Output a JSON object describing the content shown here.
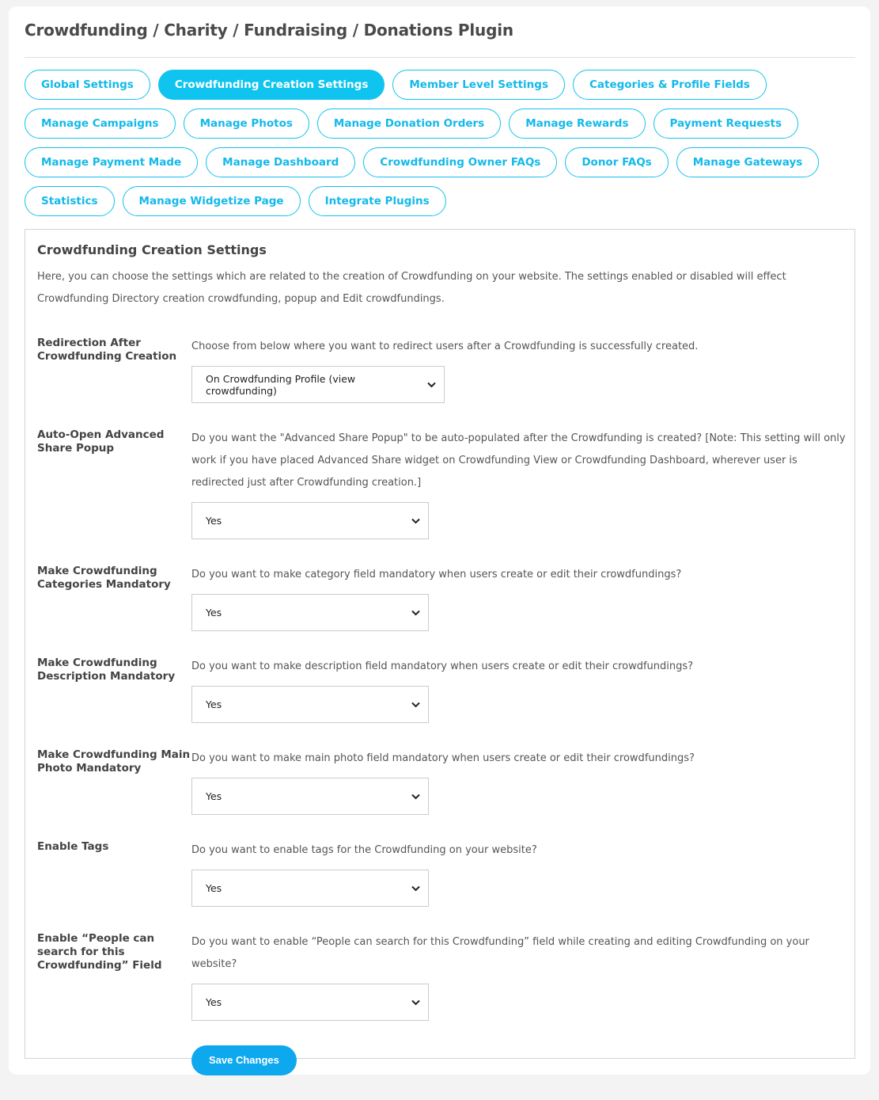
{
  "title": "Crowdfunding / Charity / Fundraising / Donations Plugin",
  "tabs": [
    {
      "label": "Global Settings",
      "active": false
    },
    {
      "label": "Crowdfunding Creation Settings",
      "active": true
    },
    {
      "label": "Member Level Settings",
      "active": false
    },
    {
      "label": "Categories & Profile Fields",
      "active": false
    },
    {
      "label": "Manage Campaigns",
      "active": false
    },
    {
      "label": "Manage Photos",
      "active": false
    },
    {
      "label": "Manage Donation Orders",
      "active": false
    },
    {
      "label": "Manage Rewards",
      "active": false
    },
    {
      "label": "Payment Requests",
      "active": false
    },
    {
      "label": "Manage Payment Made",
      "active": false
    },
    {
      "label": "Manage Dashboard",
      "active": false
    },
    {
      "label": "Crowdfunding Owner FAQs",
      "active": false
    },
    {
      "label": "Donor FAQs",
      "active": false
    },
    {
      "label": "Manage Gateways",
      "active": false
    },
    {
      "label": "Statistics",
      "active": false
    },
    {
      "label": "Manage Widgetize Page",
      "active": false
    },
    {
      "label": "Integrate Plugins",
      "active": false
    }
  ],
  "section": {
    "title": "Crowdfunding Creation Settings",
    "description": "Here, you can choose the settings which are related to the creation of Crowdfunding on your website. The settings enabled or disabled will effect Crowdfunding Directory creation crowdfunding, popup and Edit crowdfundings.",
    "settings": [
      {
        "label": "Redirection After Crowdfunding Creation",
        "description": "Choose from below where you want to redirect users after a Crowdfunding is successfully created.",
        "value": "On Crowdfunding Profile (view crowdfunding)"
      },
      {
        "label": "Auto-Open Advanced Share Popup",
        "description": "Do you want the \"Advanced Share Popup\" to be auto-populated after the Crowdfunding is created? [Note: This setting will only work if you have placed Advanced Share widget on Crowdfunding View or Crowdfunding Dashboard, wherever user is redirected just after Crowdfunding creation.]",
        "value": "Yes"
      },
      {
        "label": "Make Crowdfunding Categories Mandatory",
        "description": "Do you want to make category field mandatory when users create or edit their crowdfundings?",
        "value": "Yes"
      },
      {
        "label": "Make Crowdfunding Description Mandatory",
        "description": "Do you want to make description field mandatory when users create or edit their crowdfundings?",
        "value": "Yes"
      },
      {
        "label": "Make Crowdfunding Main Photo Mandatory",
        "description": "Do you want to make main photo field mandatory when users create or edit their crowdfundings?",
        "value": "Yes"
      },
      {
        "label": "Enable Tags",
        "description": "Do you want to enable tags for the Crowdfunding on your website?",
        "value": "Yes"
      },
      {
        "label": "Enable “People can search for this Crowdfunding” Field",
        "description": "Do you want to enable “People can search for this Crowdfunding” field while creating and editing Crowdfunding on your website?",
        "value": "Yes"
      }
    ],
    "save_label": "Save Changes"
  },
  "colors": {
    "accent": "#0fc4ef",
    "save": "#0ea8ef"
  }
}
